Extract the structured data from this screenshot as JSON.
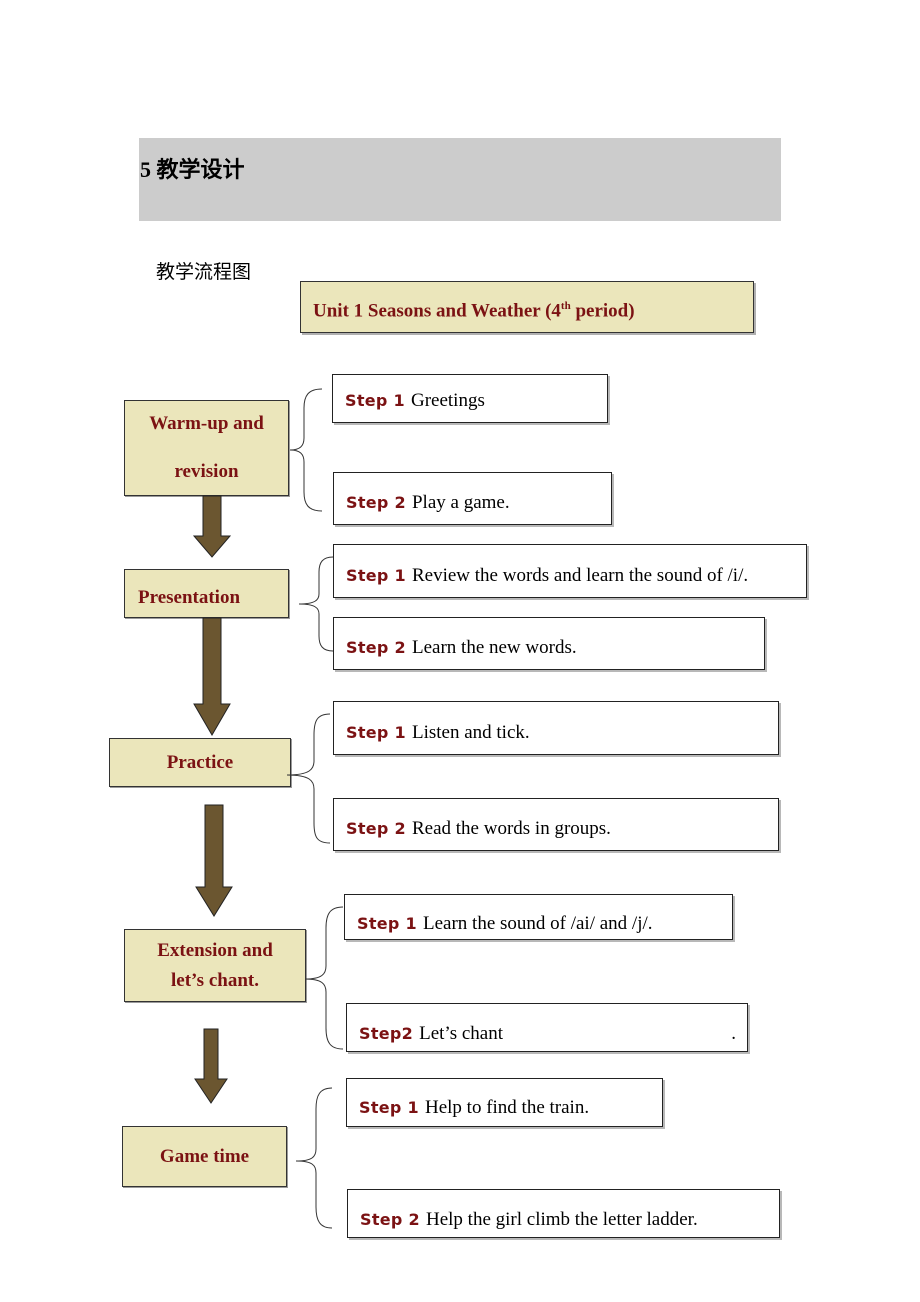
{
  "section": {
    "title": "5 教学设计"
  },
  "flowchart": {
    "label": "教学流程图",
    "title_main": "Unit 1 Seasons and Weather (4",
    "title_sup": "th",
    "title_end": " period)",
    "colors": {
      "stage_fill": "#ebe6bb",
      "text_accent": "#7b1213",
      "arrow_fill": "#6b5630"
    },
    "stages": [
      {
        "name": "Warm-up and revision",
        "line1": "Warm-up and",
        "line2": "revision",
        "steps": [
          {
            "label": "Step 1",
            "text": "Greetings"
          },
          {
            "label": "Step 2",
            "text": "Play a game."
          }
        ]
      },
      {
        "name": "Presentation",
        "line1": "Presentation",
        "steps": [
          {
            "label": "Step 1",
            "text": "Review the words and learn the sound of /i/."
          },
          {
            "label": "Step 2",
            "text": "Learn the new words."
          }
        ]
      },
      {
        "name": "Practice",
        "line1": "Practice",
        "steps": [
          {
            "label": "Step 1",
            "text": "Listen and tick."
          },
          {
            "label": "Step 2",
            "text": "Read the words in groups."
          }
        ]
      },
      {
        "name": "Extension and let’s chant.",
        "line1": "Extension and",
        "line2": "let’s chant.",
        "steps": [
          {
            "label": "Step 1",
            "text": "Learn the sound of /ai/ and /j/."
          },
          {
            "label": "Step2",
            "text": "Let’s  chant",
            "trailing": "."
          }
        ]
      },
      {
        "name": "Game time",
        "line1": "Game time",
        "steps": [
          {
            "label": "Step 1",
            "text": "Help to find the train."
          },
          {
            "label": "Step 2",
            "text": "Help the girl climb the letter ladder."
          }
        ]
      }
    ]
  }
}
